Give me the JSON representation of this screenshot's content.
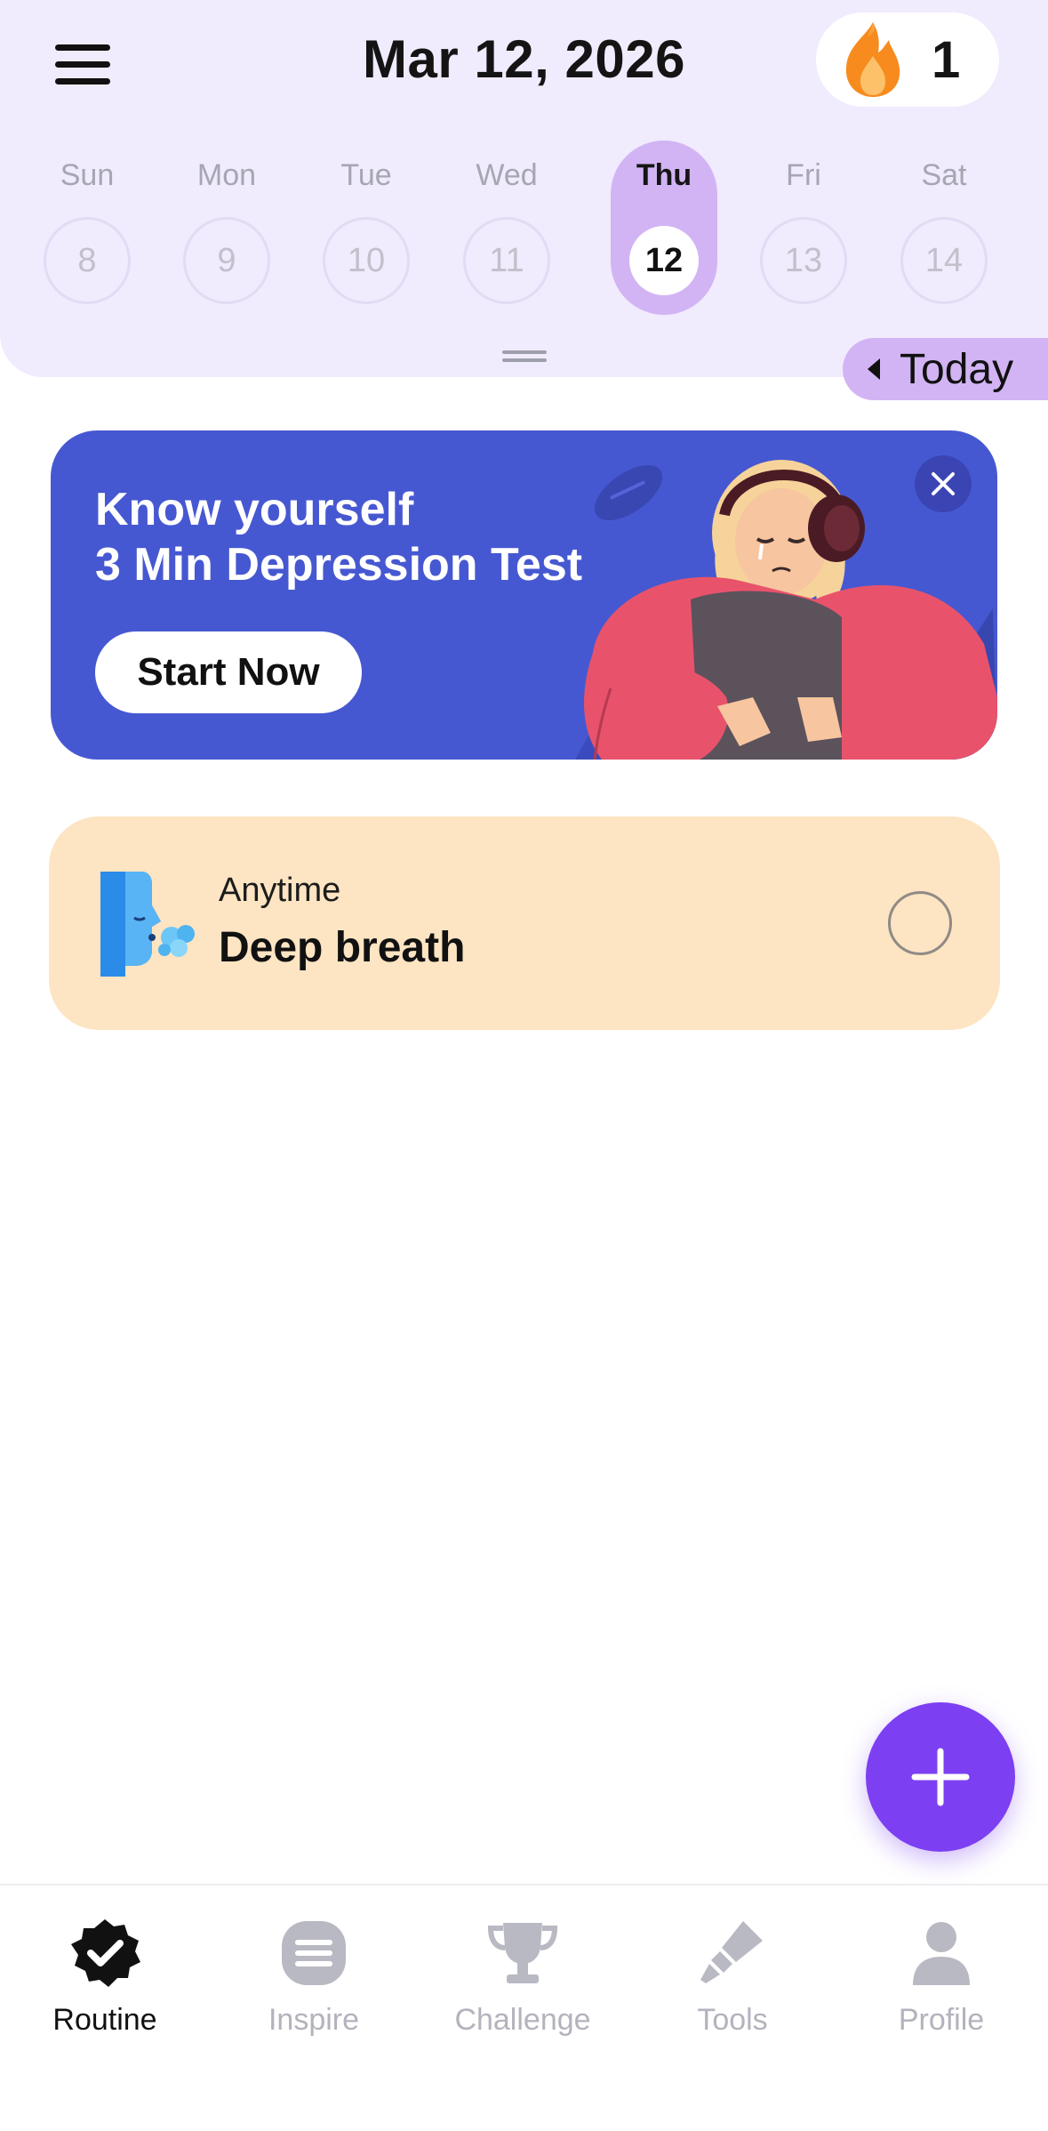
{
  "header": {
    "date_title": "Mar 12, 2026",
    "streak_count": "1",
    "streak_icon": "flame-icon"
  },
  "week": {
    "days": [
      {
        "name": "Sun",
        "num": "8",
        "selected": false
      },
      {
        "name": "Mon",
        "num": "9",
        "selected": false
      },
      {
        "name": "Tue",
        "num": "10",
        "selected": false
      },
      {
        "name": "Wed",
        "num": "11",
        "selected": false
      },
      {
        "name": "Thu",
        "num": "12",
        "selected": true
      },
      {
        "name": "Fri",
        "num": "13",
        "selected": false
      },
      {
        "name": "Sat",
        "num": "14",
        "selected": false
      }
    ],
    "today_label": "Today"
  },
  "banner": {
    "title_line1": "Know yourself",
    "title_line2": "3 Min Depression Test",
    "cta_label": "Start Now"
  },
  "tasks": [
    {
      "time": "Anytime",
      "name": "Deep breath",
      "completed": false,
      "icon": "breath-face-icon"
    }
  ],
  "fab": {
    "icon": "plus-icon"
  },
  "bottom_nav": {
    "items": [
      {
        "label": "Routine",
        "icon": "check-badge-icon",
        "active": true
      },
      {
        "label": "Inspire",
        "icon": "list-icon",
        "active": false
      },
      {
        "label": "Challenge",
        "icon": "trophy-icon",
        "active": false
      },
      {
        "label": "Tools",
        "icon": "brush-icon",
        "active": false
      },
      {
        "label": "Profile",
        "icon": "person-icon",
        "active": false
      }
    ]
  },
  "colors": {
    "header_bg": "#f1ebfe",
    "selected_day": "#d2b4f4",
    "banner_bg": "#4658d1",
    "task_bg": "#fde4c2",
    "fab": "#7c3ff2"
  }
}
